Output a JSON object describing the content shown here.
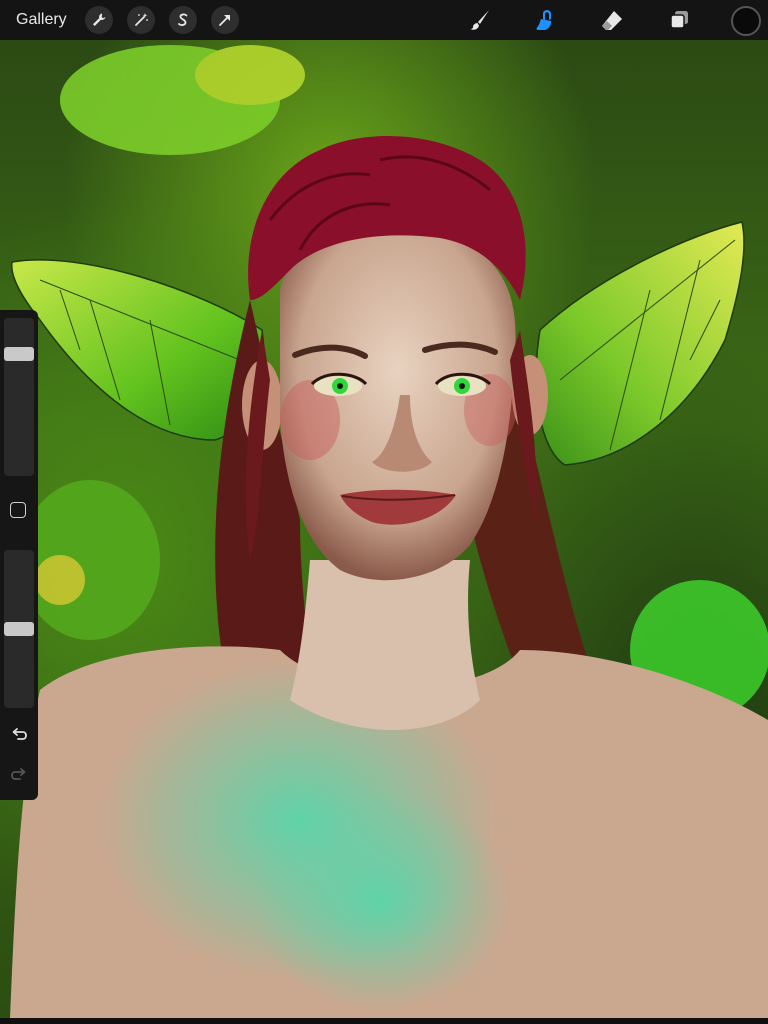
{
  "app": {
    "gallery_label": "Gallery"
  },
  "toolbar": {
    "left_tools": [
      "wrench-icon",
      "magic-wand-icon",
      "selection-icon",
      "transform-arrow-icon"
    ],
    "right_tools": [
      "brush-icon",
      "smudge-icon",
      "eraser-icon",
      "layers-icon"
    ],
    "active_tool": "smudge-icon",
    "active_color": "#1e90ff",
    "current_color": "#0a0a0a"
  },
  "sidebar": {
    "brush_size": 0.8,
    "opacity": 0.5,
    "controls": [
      "modify-button",
      "undo-icon",
      "redo-icon"
    ]
  },
  "colors": {
    "toolbar_bg": "#141414",
    "accent_blue": "#1e90ff",
    "icon_white": "#e8e8e8"
  }
}
